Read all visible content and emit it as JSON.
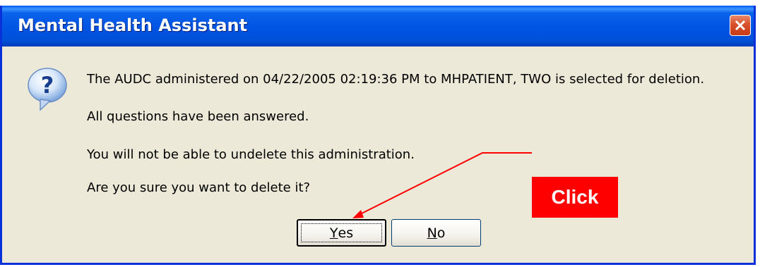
{
  "window": {
    "title": "Mental Health Assistant",
    "close_icon": "close-icon"
  },
  "dialog": {
    "icon": "question-icon",
    "icon_glyph": "?",
    "lines": [
      "The AUDC administered on 04/22/2005 02:19:36 PM to MHPATIENT, TWO is selected for deletion.",
      "All questions have been answered.",
      "You will not be able to undelete this administration.",
      "Are you sure you want to delete it?"
    ]
  },
  "buttons": {
    "yes": {
      "hotkey": "Y",
      "rest": "es"
    },
    "no": {
      "hotkey": "N",
      "rest": "o"
    }
  },
  "annotation": {
    "label": "Click",
    "color": "#ff0000"
  }
}
